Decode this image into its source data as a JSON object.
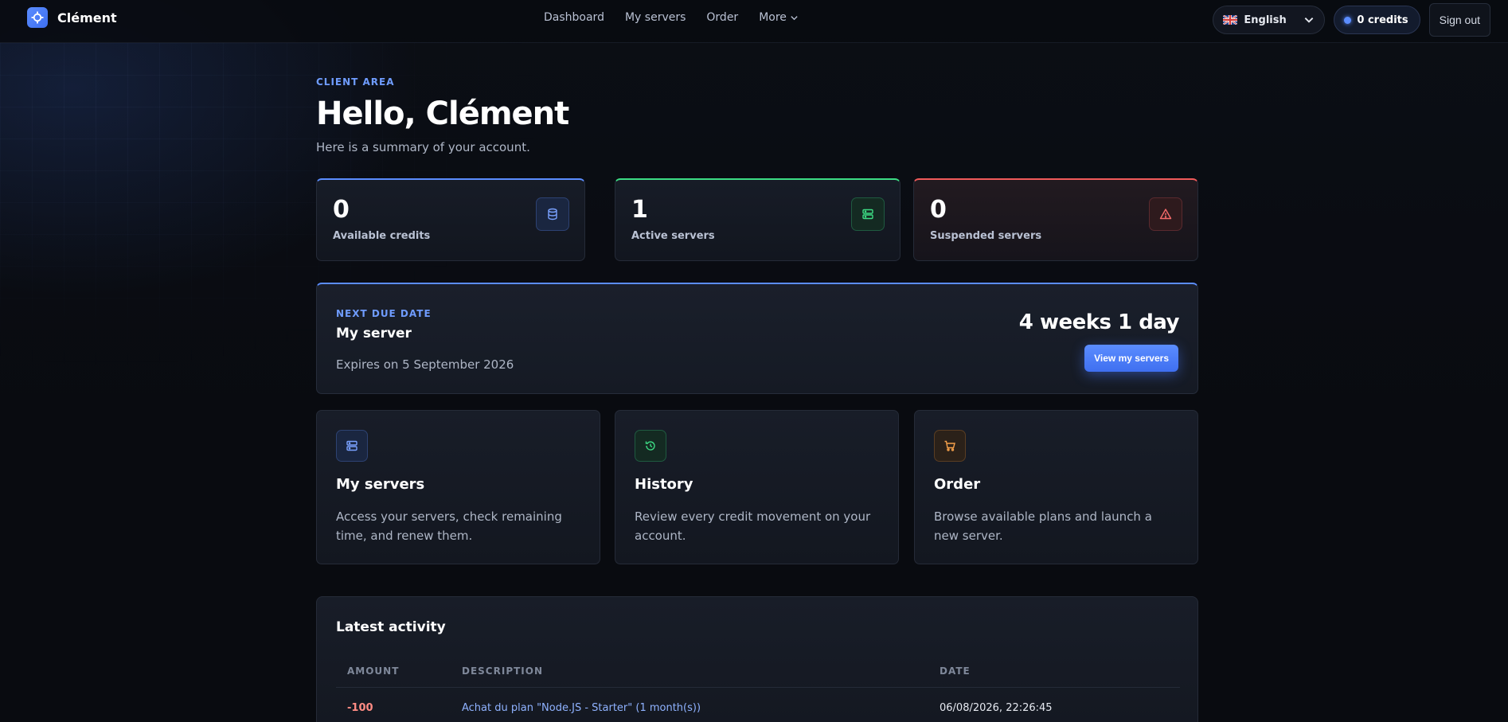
{
  "brand": {
    "name": "Clément"
  },
  "nav": {
    "links": [
      "Dashboard",
      "My servers",
      "Order"
    ],
    "more_label": "More"
  },
  "lang": {
    "label": "English"
  },
  "credits": {
    "label": "0 credits"
  },
  "signout": {
    "label": "Sign out"
  },
  "header": {
    "eyebrow": "CLIENT AREA",
    "title": "Hello, Clément",
    "subtitle": "Here is a summary of your account."
  },
  "stats": [
    {
      "value": "0",
      "label": "Available credits",
      "accent": "#5b8dff",
      "icon": "database-icon"
    },
    {
      "value": "1",
      "label": "Active servers",
      "accent": "#3ddc84",
      "icon": "server-icon"
    },
    {
      "value": "0",
      "label": "Suspended servers",
      "accent": "#f05a5a",
      "icon": "warning-icon"
    }
  ],
  "due": {
    "eyebrow": "NEXT DUE DATE",
    "title": "My server",
    "expires": "Expires on 5 September 2026",
    "remaining": "4 weeks 1 day",
    "button": "View my servers"
  },
  "cards": [
    {
      "title": "My servers",
      "desc": "Access your servers, check remaining time, and renew them.",
      "icon": "server-icon",
      "color": "#6f9cff"
    },
    {
      "title": "History",
      "desc": "Review every credit movement on your account.",
      "icon": "history-icon",
      "color": "#3ddc84"
    },
    {
      "title": "Order",
      "desc": "Browse available plans and launch a new server.",
      "icon": "cart-icon",
      "color": "#f5a04a"
    }
  ],
  "activity": {
    "title": "Latest activity",
    "headers": [
      "AMOUNT",
      "DESCRIPTION",
      "DATE"
    ],
    "rows": [
      {
        "amount": "-100",
        "desc": "Achat du plan \"Node.JS - Starter\" (1 month(s))",
        "date": "06/08/2026, 22:26:45"
      }
    ]
  }
}
